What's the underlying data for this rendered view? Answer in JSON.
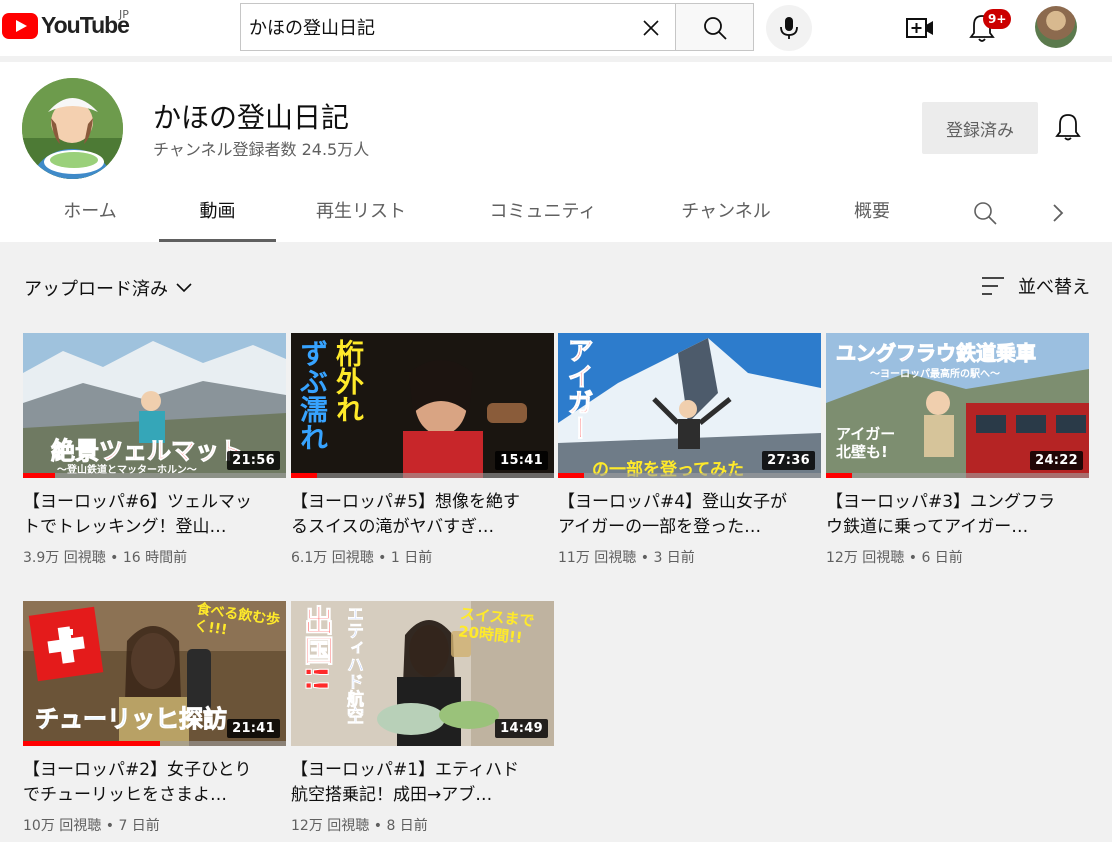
{
  "header": {
    "logo_text": "YouTube",
    "region": "JP",
    "search_value": "かほの登山日記",
    "notification_count": "9+"
  },
  "channel": {
    "name": "かほの登山日記",
    "subscribers": "チャンネル登録者数 24.5万人",
    "subscribe_label": "登録済み",
    "tabs": [
      {
        "label": "ホーム",
        "active": false
      },
      {
        "label": "動画",
        "active": true
      },
      {
        "label": "再生リスト",
        "active": false
      },
      {
        "label": "コミュニティ",
        "active": false
      },
      {
        "label": "チャンネル",
        "active": false
      },
      {
        "label": "概要",
        "active": false
      }
    ]
  },
  "filter": {
    "uploads_label": "アップロード済み",
    "sort_label": "並べ替え"
  },
  "videos": [
    {
      "title": "【ヨーロッパ#6】ツェルマットでトレッキング！登山…",
      "views": "3.9万 回視聴",
      "age": "16 時間前",
      "duration": "21:56",
      "progress": 0.12,
      "overlay": "絶景ツェルマット",
      "overlay_sub": "〜登山鉄道とマッターホルン〜"
    },
    {
      "title": "【ヨーロッパ#5】想像を絶するスイスの滝がヤバすぎ…",
      "views": "6.1万 回視聴",
      "age": "1 日前",
      "duration": "15:41",
      "progress": 0.1,
      "overlay_a": "桁外れ",
      "overlay_b": "ずぶ濡れ"
    },
    {
      "title": "【ヨーロッパ#4】登山女子がアイガーの一部を登った…",
      "views": "11万 回視聴",
      "age": "3 日前",
      "duration": "27:36",
      "progress": 0.1,
      "overlay_a": "アイガー",
      "overlay_b": "の一部を登ってみた"
    },
    {
      "title": "【ヨーロッパ#3】ユングフラウ鉄道に乗ってアイガー…",
      "views": "12万 回視聴",
      "age": "6 日前",
      "duration": "24:22",
      "progress": 0.1,
      "overlay": "ユングフラウ鉄道乗車",
      "overlay_sub": "〜ヨーロッパ最高所の駅へ〜",
      "overlay_c": "アイガー北壁も!"
    },
    {
      "title": "【ヨーロッパ#2】女子ひとりでチューリッヒをさまよ…",
      "views": "10万 回視聴",
      "age": "7 日前",
      "duration": "21:41",
      "progress": 0.52,
      "overlay": "チューリッヒ探訪",
      "overlay_b": "食べる飲む歩く!!!"
    },
    {
      "title": "【ヨーロッパ#1】エティハド航空搭乗記！成田→アブ…",
      "views": "12万 回視聴",
      "age": "8 日前",
      "duration": "14:49",
      "progress": 0,
      "overlay_a": "出国!!",
      "overlay_b": "エティハド航空",
      "overlay_c": "スイスまで20時間!!"
    }
  ]
}
